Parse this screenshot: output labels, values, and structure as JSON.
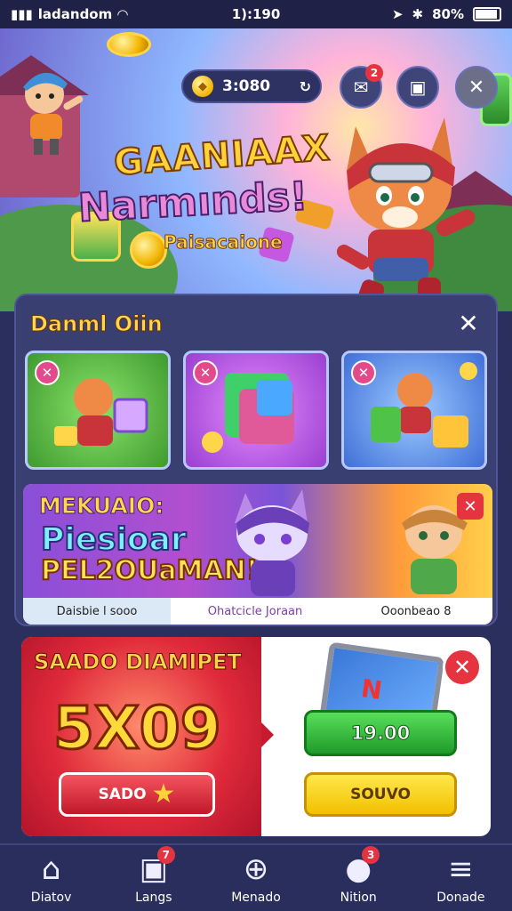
{
  "status_bar": {
    "carrier": "ladandom",
    "time": "1):190",
    "battery": "80%"
  },
  "header": {
    "coin_balance": "3:080",
    "mail_badge": "2"
  },
  "hero": {
    "title_line1": "GAANIAAX",
    "title_line2": "Narmınds!",
    "subtitle": "Paisacaione"
  },
  "panel": {
    "title": "Danml Oiin",
    "close_label": "✕",
    "tiles": [
      {
        "badge": "✕",
        "color": "#5fbf3f"
      },
      {
        "badge": "✕",
        "color": "#b44fd0"
      },
      {
        "badge": "✕",
        "color": "#3f7fe0"
      }
    ],
    "banner": {
      "line1": "MEKUAIO:",
      "line2": "Piesioar",
      "line3": "PEL2OUaMAN!",
      "close_label": "✕",
      "labels": [
        "Daisbie l sooo",
        "Ohatcicle Joraan",
        "Ooonbeao 8"
      ]
    }
  },
  "offer": {
    "title": "SAADO DIAMIPET",
    "amount": "5X09",
    "left_button": "SADO",
    "price_button": "19.00",
    "secondary_button": "SOUVO",
    "close_label": "✕"
  },
  "nav": {
    "items": [
      {
        "label": "Diatov",
        "icon": "home-icon",
        "badge": ""
      },
      {
        "label": "Langs",
        "icon": "gift-icon",
        "badge": "7"
      },
      {
        "label": "Menado",
        "icon": "plus-circle-icon",
        "badge": ""
      },
      {
        "label": "Nition",
        "icon": "chat-icon",
        "badge": "3"
      },
      {
        "label": "Donade",
        "icon": "menu-icon",
        "badge": ""
      }
    ]
  }
}
